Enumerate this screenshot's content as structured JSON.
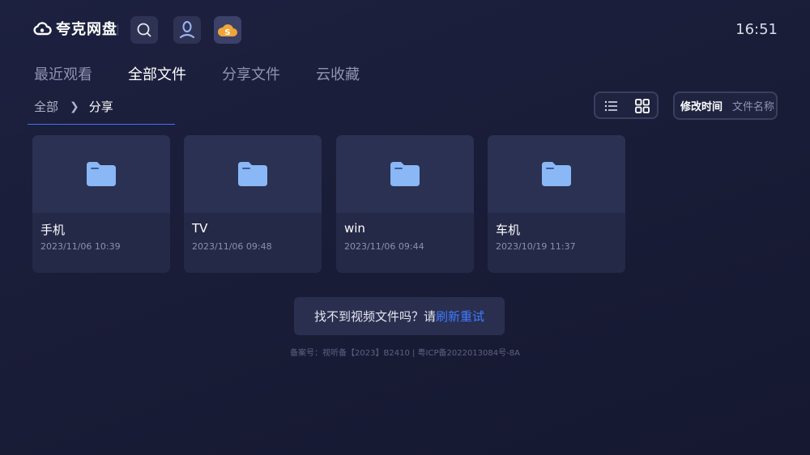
{
  "app": {
    "name": "夸克网盘",
    "clock": "16:51"
  },
  "header": {
    "buttons": [
      {
        "name": "search-icon"
      },
      {
        "name": "user-avatar-icon"
      },
      {
        "name": "cloud-s-icon"
      }
    ]
  },
  "tabs": [
    {
      "label": "最近观看",
      "active": false
    },
    {
      "label": "全部文件",
      "active": true
    },
    {
      "label": "分享文件",
      "active": false
    },
    {
      "label": "云收藏",
      "active": false
    }
  ],
  "breadcrumb": {
    "root": "全部",
    "current": "分享"
  },
  "sort": {
    "active": "修改时间",
    "other": "文件名称"
  },
  "files": [
    {
      "name": "手机",
      "date": "2023/11/06 10:39"
    },
    {
      "name": "TV",
      "date": "2023/11/06 09:48"
    },
    {
      "name": "win",
      "date": "2023/11/06 09:44"
    },
    {
      "name": "车机",
      "date": "2023/10/19 11:37"
    }
  ],
  "notice": {
    "prefix": "找不到视频文件吗？请",
    "link": "刷新重试"
  },
  "footer": {
    "icp": "备案号：视听备【2023】B2410 | 粤ICP备2022013084号-8A"
  },
  "colors": {
    "accent": "#3c73f5",
    "folder": "#8ab7f5",
    "logo_orange": "#f0a53a"
  }
}
